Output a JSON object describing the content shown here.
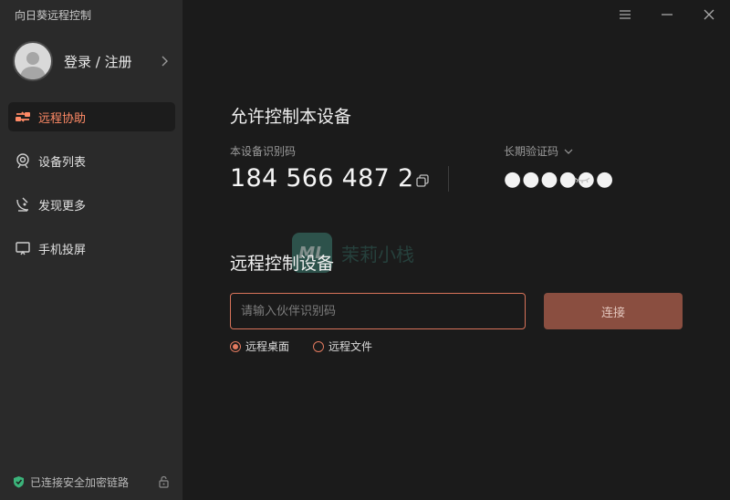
{
  "app": {
    "title": "向日葵远程控制"
  },
  "user": {
    "label": "登录 / 注册"
  },
  "sidebar": {
    "items": [
      {
        "label": "远程协助",
        "icon": "remote-assist-icon",
        "active": true
      },
      {
        "label": "设备列表",
        "icon": "device-list-icon",
        "active": false
      },
      {
        "label": "发现更多",
        "icon": "discover-icon",
        "active": false
      },
      {
        "label": "手机投屏",
        "icon": "screen-cast-icon",
        "active": false
      }
    ],
    "footer": {
      "status": "已连接安全加密链路"
    }
  },
  "allow_control": {
    "title": "允许控制本设备",
    "device_id_label": "本设备识别码",
    "device_id": "184 566 487 2",
    "password_label": "长期验证码",
    "password_masked": "●●●●●●"
  },
  "remote_control": {
    "title": "远程控制设备",
    "partner_placeholder": "请输入伙伴识别码",
    "connect_label": "连接",
    "options": [
      {
        "label": "远程桌面",
        "selected": true
      },
      {
        "label": "远程文件",
        "selected": false
      }
    ]
  },
  "watermark": {
    "logo_text": "ML",
    "text": "茉莉小栈"
  },
  "colors": {
    "accent": "#ff8a66",
    "sidebar_bg": "#2a2a2a",
    "main_bg": "#1b1b1b",
    "connect_btn": "#8a4e40",
    "input_border": "#d8735a",
    "secure_green": "#3bb37a"
  }
}
